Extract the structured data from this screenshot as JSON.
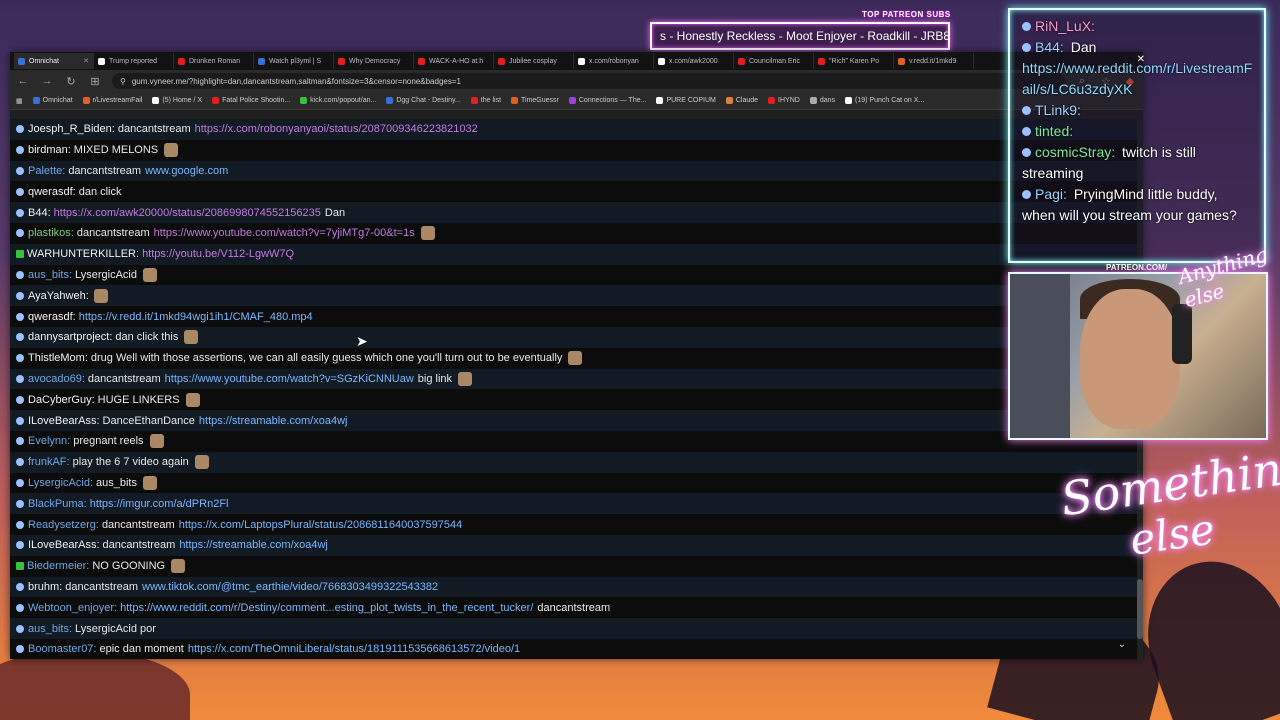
{
  "overlay": {
    "subs_title": "TOP PATREON SUBS",
    "subs_ticker": "s - Honestly Reckless - Moot Enjoyer - Roadkill - JRB8567",
    "cam_label": "PATREON.COM/",
    "cursive_top": "Anything else",
    "cursive_line1": "Something",
    "cursive_line2": "else"
  },
  "side_chat": [
    {
      "nick": "RiN_LuX:",
      "text": "",
      "nick_class": ""
    },
    {
      "nick": "B44:",
      "text": "Dan",
      "nick_class": "b"
    },
    {
      "nick": "",
      "text": "",
      "link": "https://www.reddit.com/r/LivestreamFail/s/LC6u3zdyXK"
    },
    {
      "nick": "TLink9:",
      "text": "",
      "nick_class": "b"
    },
    {
      "nick": "tinted:",
      "text": "",
      "nick_class": "g"
    },
    {
      "nick": "cosmicStray:",
      "text": "twitch is still streaming",
      "nick_class": "g"
    },
    {
      "nick": "Pagi:",
      "text": "PryingMind little buddy, when will you stream your games?",
      "nick_class": "b"
    }
  ],
  "browser": {
    "tabs": [
      {
        "label": "Omnichat",
        "color": "#3a6fd8",
        "active": true
      },
      {
        "label": "Trump reported",
        "color": "#fff"
      },
      {
        "label": "Drunken Roman",
        "color": "#e02020"
      },
      {
        "label": "Watch pl3yml | S",
        "color": "#3a6fd8"
      },
      {
        "label": "Why Democracy",
        "color": "#e02020"
      },
      {
        "label": "WACK-A-HO at h",
        "color": "#e02020"
      },
      {
        "label": "Jubilee cosplay",
        "color": "#e02020"
      },
      {
        "label": "x.com/robonyan",
        "color": "#fff"
      },
      {
        "label": "x.com/awk2000",
        "color": "#fff"
      },
      {
        "label": "Councilman Eric",
        "color": "#e02020"
      },
      {
        "label": "\"Rich\" Karen Po",
        "color": "#e02020"
      },
      {
        "label": "v.redd.it/1mkd9",
        "color": "#e06020"
      }
    ],
    "url": "gum.vyneer.me/?highlight=dan,dancantstream,saltman&fontsize=3&censor=none&badges=1",
    "bookmarks": [
      {
        "label": "Omnichat",
        "color": "#3a6fd8"
      },
      {
        "label": "r/LivestreamFail",
        "color": "#e06020"
      },
      {
        "label": "(5) Home / X",
        "color": "#fff"
      },
      {
        "label": "Fatal Police Shootin...",
        "color": "#e02020"
      },
      {
        "label": "kick.com/popout/an...",
        "color": "#3ac03a"
      },
      {
        "label": "Dgg Chat - Destiny...",
        "color": "#3a6fd8"
      },
      {
        "label": "the list",
        "color": "#e02020"
      },
      {
        "label": "TimeGuessr",
        "color": "#e06020"
      },
      {
        "label": "Connections — The...",
        "color": "#a040e0"
      },
      {
        "label": "PURE COPIUM",
        "color": "#fff"
      },
      {
        "label": "Claude",
        "color": "#e08040"
      },
      {
        "label": "IHYND",
        "color": "#e02020"
      },
      {
        "label": "dans",
        "color": "#aaa"
      },
      {
        "label": "(19) Punch Cat on X...",
        "color": "#fff"
      }
    ]
  },
  "chat": [
    {
      "nick": "Joesph_R_Biden:",
      "nick_class": "white",
      "text": "dancantstream",
      "link": "https://x.com/robonyanyaoi/status/2087009346223821032",
      "link_class": "purple",
      "emote": false,
      "badge": ""
    },
    {
      "nick": "birdman:",
      "nick_class": "white",
      "text": "MIXED MELONS",
      "link": "",
      "emote": true,
      "badge": ""
    },
    {
      "nick": "Palette:",
      "nick_class": "blue",
      "text": "dancantstream",
      "link": "www.google.com",
      "emote": false,
      "badge": ""
    },
    {
      "nick": "qwerasdf:",
      "nick_class": "white",
      "text": "dan click",
      "link": "",
      "emote": false,
      "badge": ""
    },
    {
      "nick": "B44:",
      "nick_class": "white",
      "text": "",
      "link": "https://x.com/awk20000/status/2086998074552156235",
      "link_class": "purple",
      "after": "Dan",
      "emote": false,
      "badge": ""
    },
    {
      "nick": "plastikos:",
      "nick_class": "green",
      "text": "dancantstream",
      "link": "https://www.youtube.com/watch?v=7yjiMTg7-00&t=1s",
      "link_class": "purple",
      "emote": true,
      "badge": ""
    },
    {
      "nick": "WARHUNTERKILLER:",
      "nick_class": "white",
      "text": "",
      "link": "https://youtu.be/V112-LgwW7Q",
      "link_class": "purple",
      "emote": false,
      "badge": "#3ac03a"
    },
    {
      "nick": "aus_bits:",
      "nick_class": "blue",
      "text": "LysergicAcid",
      "link": "",
      "emote": true,
      "badge": ""
    },
    {
      "nick": "AyaYahweh:",
      "nick_class": "white",
      "text": "",
      "link": "",
      "emote": true,
      "badge": ""
    },
    {
      "nick": "qwerasdf:",
      "nick_class": "white",
      "text": "",
      "link": "https://v.redd.it/1mkd94wgi1ih1/CMAF_480.mp4",
      "link_class": "",
      "emote": false,
      "badge": ""
    },
    {
      "nick": "dannysartproject:",
      "nick_class": "white",
      "text": "dan click this",
      "link": "",
      "emote": true,
      "badge": ""
    },
    {
      "nick": "ThistleMom:",
      "nick_class": "white",
      "text": "drug Well with those assertions, we can all easily guess which one you'll turn out to be eventually",
      "link": "",
      "emote": true,
      "badge": ""
    },
    {
      "nick": "avocado69:",
      "nick_class": "blue",
      "text": "dancantstream",
      "link": "https://www.youtube.com/watch?v=SGzKiCNNUaw",
      "link_class": "",
      "after": "big link",
      "emote": true,
      "badge": ""
    },
    {
      "nick": "DaCyberGuy:",
      "nick_class": "white",
      "text": "HUGE LINKERS",
      "link": "",
      "emote": true,
      "badge": ""
    },
    {
      "nick": "ILoveBearAss:",
      "nick_class": "white",
      "text": "DanceEthanDance",
      "link": "https://streamable.com/xoa4wj",
      "link_class": "",
      "emote": false,
      "badge": ""
    },
    {
      "nick": "Evelynn:",
      "nick_class": "blue",
      "text": "pregnant reels",
      "link": "",
      "emote": true,
      "badge": ""
    },
    {
      "nick": "frunkAF:",
      "nick_class": "blue",
      "text": "play the 6 7 video again",
      "link": "",
      "emote": true,
      "badge": ""
    },
    {
      "nick": "LysergicAcid:",
      "nick_class": "blue",
      "text": "aus_bits",
      "link": "",
      "emote": true,
      "badge": ""
    },
    {
      "nick": "BlackPuma:",
      "nick_class": "blue",
      "text": "",
      "link": "https://imgur.com/a/dPRn2Fl",
      "link_class": "",
      "emote": false,
      "badge": ""
    },
    {
      "nick": "Readysetzerg:",
      "nick_class": "blue",
      "text": "dancantstream",
      "link": "https://x.com/LaptopsPlural/status/2086811640037597544",
      "link_class": "",
      "emote": false,
      "badge": ""
    },
    {
      "nick": "ILoveBearAss:",
      "nick_class": "white",
      "text": "dancantstream",
      "link": "https://streamable.com/xoa4wj",
      "link_class": "",
      "emote": false,
      "badge": ""
    },
    {
      "nick": "Biedermeier:",
      "nick_class": "blue",
      "text": "NO GOONING",
      "link": "",
      "emote": true,
      "badge": "#3ac03a"
    },
    {
      "nick": "bruhm:",
      "nick_class": "white",
      "text": "dancantstream",
      "link": "www.tiktok.com/@tmc_earthie/video/7668303499322543382",
      "link_class": "",
      "emote": false,
      "badge": ""
    },
    {
      "nick": "Webtoon_enjoyer:",
      "nick_class": "blue",
      "text": "",
      "link": "https://www.reddit.com/r/Destiny/comment...esting_plot_twists_in_the_recent_tucker/",
      "link_class": "",
      "after": "dancantstream",
      "emote": false,
      "badge": ""
    },
    {
      "nick": "aus_bits:",
      "nick_class": "blue",
      "text": "LysergicAcid por",
      "link": "",
      "emote": false,
      "badge": ""
    },
    {
      "nick": "Boomaster07:",
      "nick_class": "blue",
      "text": "epic dan moment",
      "link": "https://x.com/TheOmniLiberal/status/1819111535668613572/video/1",
      "link_class": "",
      "emote": false,
      "badge": ""
    }
  ],
  "colors": {
    "accent_link": "#7ab8ff",
    "accent_purple": "#c47ae0",
    "nick_green": "#7fcf7f",
    "nick_blue": "#6fa9e6"
  }
}
